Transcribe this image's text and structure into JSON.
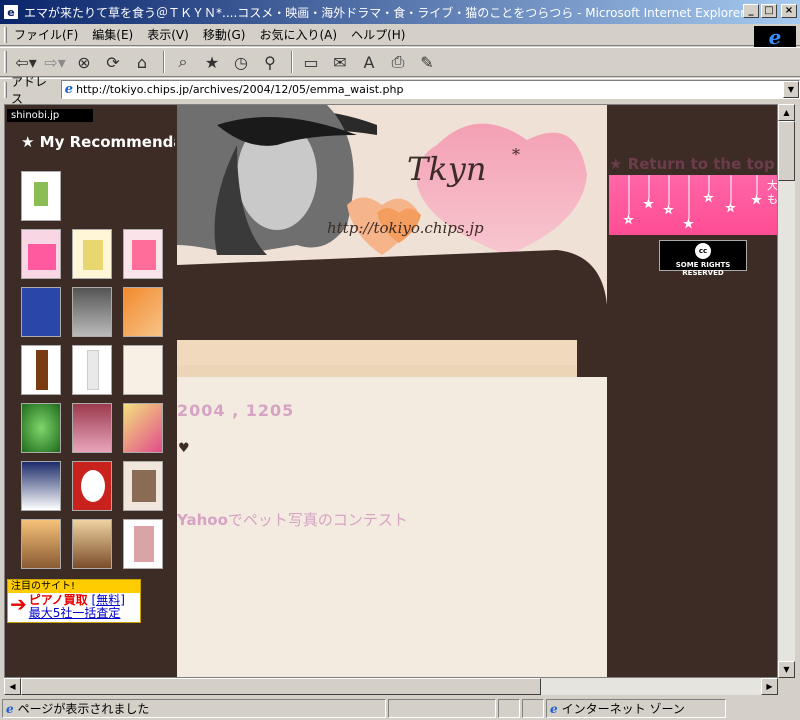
{
  "window": {
    "title": "エマが来たりて草を食う＠ＴＫＹＮ*....コスメ・映画・海外ドラマ・食・ライブ・猫のことをつらつら - Microsoft Internet Explorer",
    "minimize": "_",
    "maximize": "□",
    "close": "×"
  },
  "menu": {
    "file": "ファイル(F)",
    "edit": "編集(E)",
    "view": "表示(V)",
    "go": "移動(G)",
    "favorites": "お気に入り(A)",
    "help": "ヘルプ(H)"
  },
  "address": {
    "label": "アドレス",
    "url": "http://tokiyo.chips.jp/archives/2004/12/05/emma_waist.php"
  },
  "page": {
    "shinobi": "shinobi.jp",
    "recommend_title": "★ My Recommendations",
    "banner_title": "Tkyn",
    "banner_url": "http://tokiyo.chips.jp",
    "date": "2004 , 1205",
    "heart": "♥",
    "yahoo_brand": "Yahoo",
    "yahoo_text": "でペット写真のコンテスト",
    "return_top": "★ Return to the top",
    "pink_banner_text": "大\nも",
    "cc_text": "SOME RIGHTS RESERVED",
    "attention_head": "注目のサイト!",
    "attention_link1": "ピアノ買取",
    "attention_link1b": "[無料]",
    "attention_link2": "最大5社一括査定"
  },
  "status": {
    "text": "ページが表示されました",
    "zone": "インターネット ゾーン"
  },
  "colors": {
    "page_bg": "#3d2b26",
    "center_bg": "#f4ebe0",
    "accent_pink": "#d6a3c4"
  }
}
